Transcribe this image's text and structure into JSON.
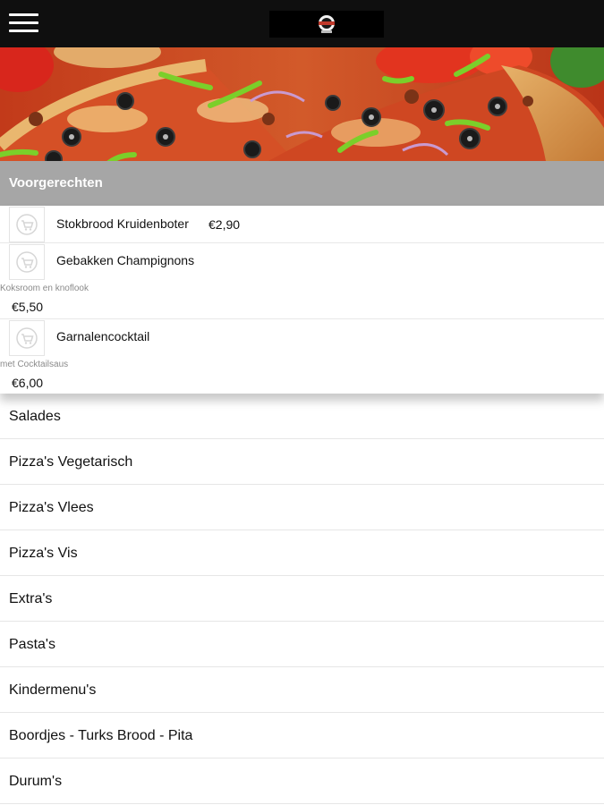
{
  "header": {
    "menu_icon": "hamburger-menu-icon",
    "logo_icon": "pizzeria-logo-icon"
  },
  "hero": {
    "image": "pizza-banner-image"
  },
  "active_category": {
    "title": "Voorgerechten",
    "items": [
      {
        "name": "Stokbrood Kruidenboter",
        "price": "€2,90",
        "description": ""
      },
      {
        "name": "Gebakken Champignons",
        "description": "Koksroom en knoflook",
        "price": "€5,50"
      },
      {
        "name": "Garnalencocktail",
        "description": "met Cocktailsaus",
        "price": "€6,00"
      }
    ]
  },
  "categories": [
    {
      "label": "Salades"
    },
    {
      "label": "Pizza's Vegetarisch"
    },
    {
      "label": "Pizza's Vlees"
    },
    {
      "label": "Pizza's Vis"
    },
    {
      "label": "Extra's"
    },
    {
      "label": "Pasta's"
    },
    {
      "label": "Kindermenu's"
    },
    {
      "label": "Boordjes - Turks Brood - Pita"
    },
    {
      "label": "Durum's"
    }
  ],
  "colors": {
    "topbar": "#0f0f0f",
    "category_header": "#a6a6a6"
  }
}
